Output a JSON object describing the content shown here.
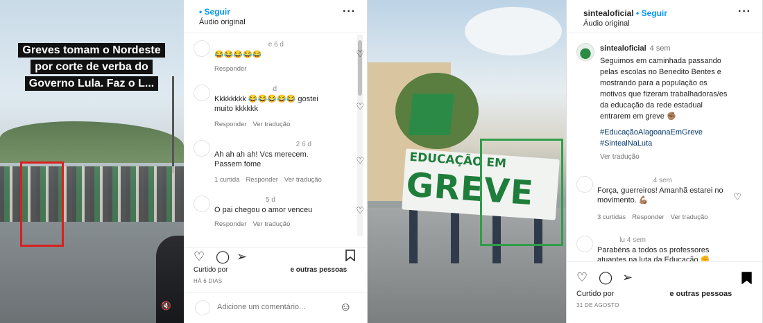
{
  "post1": {
    "photo": {
      "caption_lines": [
        "Greves tomam o Nordeste",
        "por corte de verba do",
        "Governo Lula. Faz o L..."
      ],
      "mute_icon": "mute-icon"
    },
    "header": {
      "username": "",
      "follow": "• Seguir",
      "subtitle": "Áudio original",
      "more": "···"
    },
    "comments": [
      {
        "time": "e 6 d",
        "text": "😂😂😂😂😂",
        "actions": [
          "Responder"
        ]
      },
      {
        "time": "d",
        "text": "Kkkkkkkk 😂😂😂😂😂 gostei muito kkkkkk",
        "actions": [
          "Responder",
          "Ver tradução"
        ]
      },
      {
        "time": "2 6 d",
        "text": "Ah ah ah ah! Vcs merecem. Passem fome",
        "actions": [
          "1 curtida",
          "Responder",
          "Ver tradução"
        ]
      },
      {
        "time": "5 d",
        "text": "O pai chegou o amor venceu",
        "actions": [
          "Responder",
          "Ver tradução"
        ]
      }
    ],
    "likes_prefix": "Curtido por",
    "likes_suffix": "e outras pessoas",
    "date": "HÁ 6 DIAS",
    "add_comment": "Adicione um comentário...",
    "emoji_icon": "☺"
  },
  "post2": {
    "photo": {
      "banner_line1": "EDUCAÇÃO EM",
      "banner_line2": "GREVE"
    },
    "header": {
      "username": "sintealoficial",
      "follow": "• Seguir",
      "subtitle": "Áudio original",
      "more": "···"
    },
    "caption": {
      "username": "sintealoficial",
      "time": "4 sem",
      "text": "Seguimos em caminhada passando pelas escolas no Benedito Bentes e mostrando para a população os motivos que fizeram trabalhadoras/es da educação da rede estadual entrarem em greve ✊🏽",
      "tags": "#EducaçãoAlagoanaEmGreve #SintealNaLuta",
      "translate": "Ver tradução"
    },
    "comments": [
      {
        "time": "4 sem",
        "text": "Força, guerreiros! Amanhã estarei no movimento. 💪🏽",
        "actions": [
          "3 curtidas",
          "Responder",
          "Ver tradução"
        ]
      },
      {
        "time": "lu 4 sem",
        "text": "Parabéns a todos os professores atuantes na luta da Educação ✊",
        "actions": []
      }
    ],
    "likes_prefix": "Curtido por",
    "likes_suffix": "e outras pessoas",
    "date": "31 DE AGOSTO"
  },
  "colors": {
    "follow": "#0095f6",
    "red_highlight": "#d8201f",
    "green_highlight": "#2f9e49",
    "banner_green": "#1e7d3a"
  }
}
